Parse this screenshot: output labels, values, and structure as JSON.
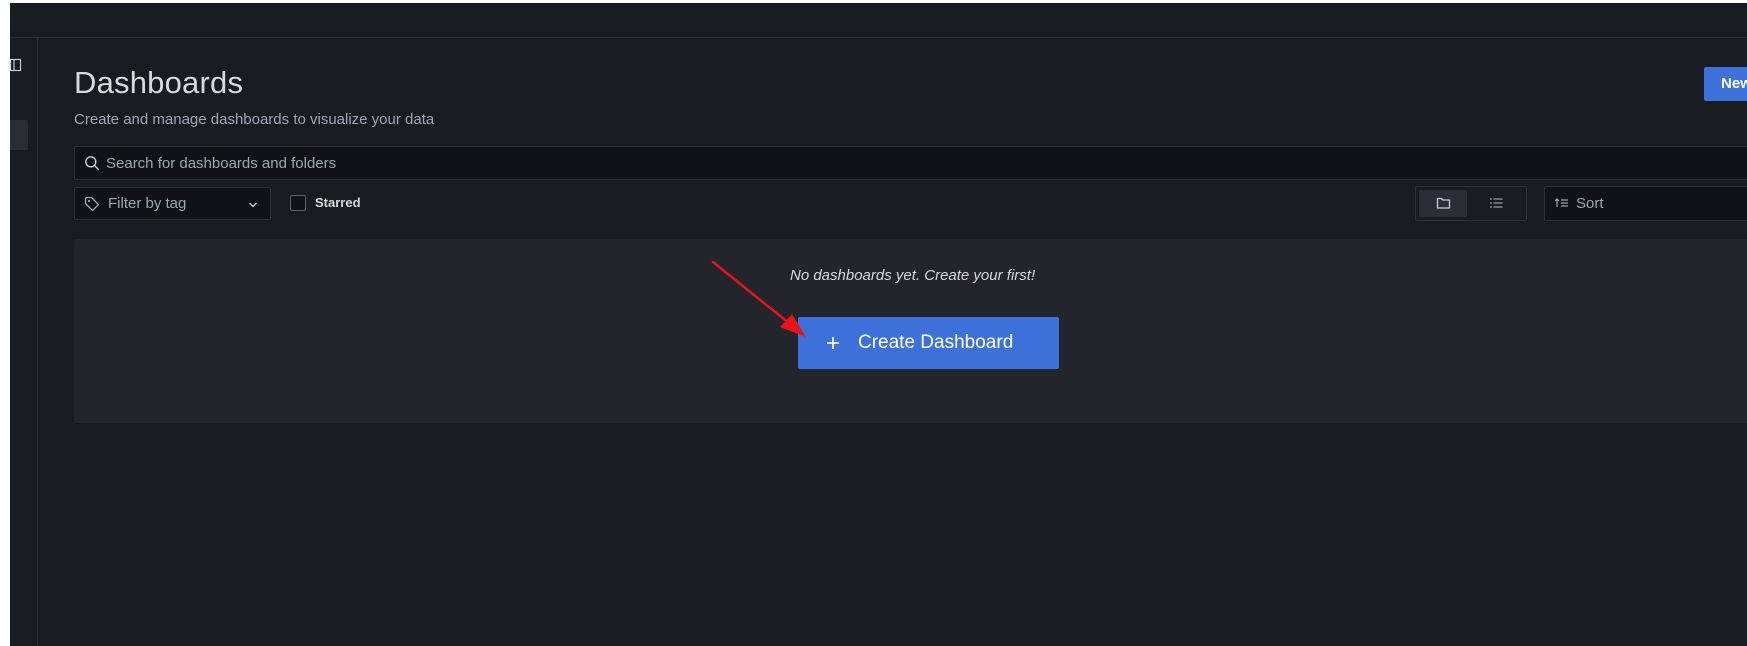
{
  "header": {
    "title": "Dashboards",
    "subtitle": "Create and manage dashboards to visualize your data",
    "new_button_label": "New"
  },
  "search": {
    "placeholder": "Search for dashboards and folders"
  },
  "filters": {
    "tag_filter_label": "Filter by tag",
    "starred_label": "Starred",
    "starred_checked": false,
    "sort_label": "Sort",
    "view_mode": "folder"
  },
  "empty_state": {
    "message": "No dashboards yet. Create your first!",
    "create_button_label": "Create Dashboard"
  },
  "colors": {
    "background": "#181b1f",
    "panel": "#22252b",
    "primary": "#3d71d9",
    "annotation_arrow": "#e8141c"
  },
  "icons": {
    "sidebar_dock": "dock-icon",
    "search": "search-icon",
    "tag": "tag-icon",
    "chevron": "chevron-down-icon",
    "folder_view": "folder-icon",
    "list_view": "list-icon",
    "sort": "sort-icon",
    "plus": "plus-icon"
  }
}
